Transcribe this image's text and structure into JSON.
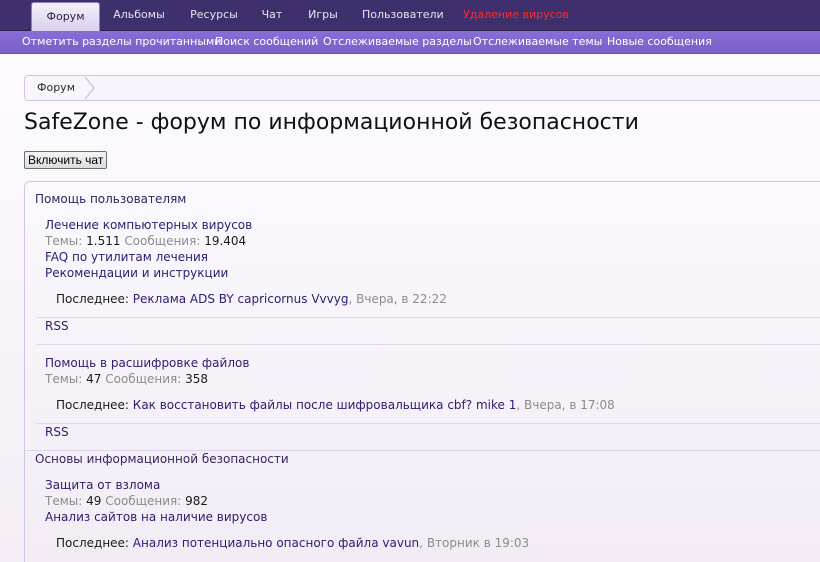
{
  "topnav": {
    "tabs": [
      {
        "label": "Форум",
        "active": true
      },
      {
        "label": "Альбомы"
      },
      {
        "label": "Ресурсы"
      },
      {
        "label": "Чат"
      },
      {
        "label": "Игры"
      },
      {
        "label": "Пользователи"
      },
      {
        "label": "Удаление вирусов",
        "alert": true
      }
    ]
  },
  "subnav": {
    "links": [
      "Отметить разделы прочитанными",
      "Поиск сообщений",
      "Отслеживаемые разделы",
      "Отслеживаемые темы",
      "Новые сообщения"
    ]
  },
  "breadcrumb": {
    "item": "Форум"
  },
  "page": {
    "title": "SafeZone - форум по информационной безопасности"
  },
  "chat_button": "Включить чат",
  "labels": {
    "topics": "Темы:",
    "posts": "Сообщения:",
    "latest": "Последнее:",
    "rss": "RSS"
  },
  "categories": [
    {
      "name": "Помощь пользователям",
      "forums": [
        {
          "title": "Лечение компьютерных вирусов",
          "topics": "1.511",
          "posts": "19.404",
          "subforums": [
            "FAQ по утилитам лечения",
            "Рекомендации и инструкции"
          ],
          "latest_thread": "Реклама ADS BY capricornus",
          "latest_user": "Vvvyg",
          "latest_time": "Вчера, в 22:22"
        },
        {
          "title": "Помощь в расшифровке файлов",
          "topics": "47",
          "posts": "358",
          "subforums": [],
          "latest_thread": "Как восстановить файлы после шифровальщика cbf?",
          "latest_user": "mike 1",
          "latest_time": "Вчера, в 17:08"
        }
      ]
    },
    {
      "name": "Основы информационной безопасности",
      "forums": [
        {
          "title": "Защита от взлома",
          "topics": "49",
          "posts": "982",
          "subforums": [
            "Анализ сайтов на наличие вирусов"
          ],
          "latest_thread": "Анализ потенциально опасного файла",
          "latest_user": "vavun",
          "latest_time": "Вторник в 19:03"
        }
      ]
    }
  ]
}
